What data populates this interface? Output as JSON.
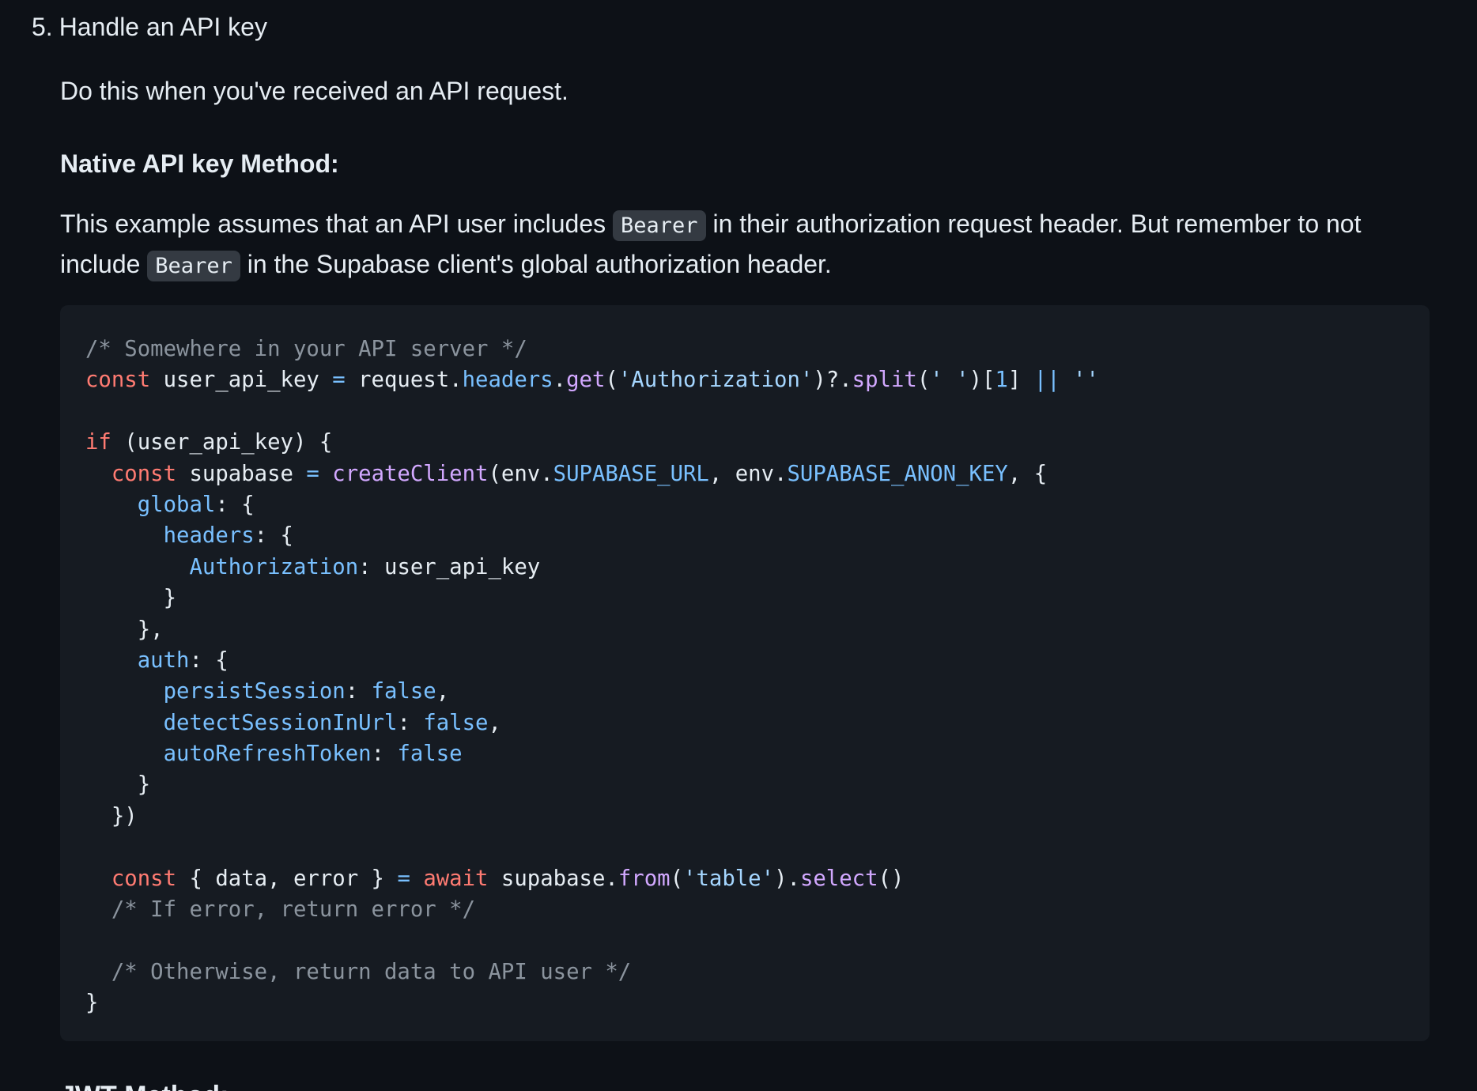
{
  "step": {
    "number": "5.",
    "title": "Handle an API key"
  },
  "intro": "Do this when you've received an API request.",
  "method_heading": "Native API key Method:",
  "example": {
    "part1": "This example assumes that an API user includes ",
    "code1": "Bearer",
    "part2": " in their authorization request header. But remember to not include ",
    "code2": "Bearer",
    "part3": " in the Supabase client's global authorization header."
  },
  "code": {
    "language": "javascript",
    "lines": [
      [
        {
          "t": "comment",
          "v": "/* Somewhere in your API server */"
        }
      ],
      [
        {
          "t": "keyword",
          "v": "const"
        },
        {
          "t": "plain",
          "v": " user_api_key "
        },
        {
          "t": "op",
          "v": "="
        },
        {
          "t": "plain",
          "v": " request."
        },
        {
          "t": "prop",
          "v": "headers"
        },
        {
          "t": "plain",
          "v": "."
        },
        {
          "t": "func",
          "v": "get"
        },
        {
          "t": "plain",
          "v": "("
        },
        {
          "t": "string",
          "v": "'Authorization'"
        },
        {
          "t": "plain",
          "v": ")?."
        },
        {
          "t": "func",
          "v": "split"
        },
        {
          "t": "plain",
          "v": "("
        },
        {
          "t": "string",
          "v": "' '"
        },
        {
          "t": "plain",
          "v": ")["
        },
        {
          "t": "number",
          "v": "1"
        },
        {
          "t": "plain",
          "v": "] "
        },
        {
          "t": "op",
          "v": "||"
        },
        {
          "t": "plain",
          "v": " "
        },
        {
          "t": "string",
          "v": "''"
        }
      ],
      [],
      [
        {
          "t": "keyword",
          "v": "if"
        },
        {
          "t": "plain",
          "v": " (user_api_key) {"
        }
      ],
      [
        {
          "t": "plain",
          "v": "  "
        },
        {
          "t": "keyword",
          "v": "const"
        },
        {
          "t": "plain",
          "v": " supabase "
        },
        {
          "t": "op",
          "v": "="
        },
        {
          "t": "plain",
          "v": " "
        },
        {
          "t": "func",
          "v": "createClient"
        },
        {
          "t": "plain",
          "v": "(env."
        },
        {
          "t": "prop",
          "v": "SUPABASE_URL"
        },
        {
          "t": "plain",
          "v": ", env."
        },
        {
          "t": "prop",
          "v": "SUPABASE_ANON_KEY"
        },
        {
          "t": "plain",
          "v": ", {"
        }
      ],
      [
        {
          "t": "plain",
          "v": "    "
        },
        {
          "t": "prop",
          "v": "global"
        },
        {
          "t": "plain",
          "v": ": {"
        }
      ],
      [
        {
          "t": "plain",
          "v": "      "
        },
        {
          "t": "prop",
          "v": "headers"
        },
        {
          "t": "plain",
          "v": ": {"
        }
      ],
      [
        {
          "t": "plain",
          "v": "        "
        },
        {
          "t": "prop",
          "v": "Authorization"
        },
        {
          "t": "plain",
          "v": ": user_api_key"
        }
      ],
      [
        {
          "t": "plain",
          "v": "      }"
        }
      ],
      [
        {
          "t": "plain",
          "v": "    },"
        }
      ],
      [
        {
          "t": "plain",
          "v": "    "
        },
        {
          "t": "prop",
          "v": "auth"
        },
        {
          "t": "plain",
          "v": ": {"
        }
      ],
      [
        {
          "t": "plain",
          "v": "      "
        },
        {
          "t": "prop",
          "v": "persistSession"
        },
        {
          "t": "plain",
          "v": ": "
        },
        {
          "t": "prop",
          "v": "false"
        },
        {
          "t": "plain",
          "v": ","
        }
      ],
      [
        {
          "t": "plain",
          "v": "      "
        },
        {
          "t": "prop",
          "v": "detectSessionInUrl"
        },
        {
          "t": "plain",
          "v": ": "
        },
        {
          "t": "prop",
          "v": "false"
        },
        {
          "t": "plain",
          "v": ","
        }
      ],
      [
        {
          "t": "plain",
          "v": "      "
        },
        {
          "t": "prop",
          "v": "autoRefreshToken"
        },
        {
          "t": "plain",
          "v": ": "
        },
        {
          "t": "prop",
          "v": "false"
        }
      ],
      [
        {
          "t": "plain",
          "v": "    }"
        }
      ],
      [
        {
          "t": "plain",
          "v": "  })"
        }
      ],
      [],
      [
        {
          "t": "plain",
          "v": "  "
        },
        {
          "t": "keyword",
          "v": "const"
        },
        {
          "t": "plain",
          "v": " { data, error } "
        },
        {
          "t": "op",
          "v": "="
        },
        {
          "t": "plain",
          "v": " "
        },
        {
          "t": "keyword",
          "v": "await"
        },
        {
          "t": "plain",
          "v": " supabase."
        },
        {
          "t": "func",
          "v": "from"
        },
        {
          "t": "plain",
          "v": "("
        },
        {
          "t": "string",
          "v": "'table'"
        },
        {
          "t": "plain",
          "v": ")."
        },
        {
          "t": "func",
          "v": "select"
        },
        {
          "t": "plain",
          "v": "()"
        }
      ],
      [
        {
          "t": "plain",
          "v": "  "
        },
        {
          "t": "comment",
          "v": "/* If error, return error */"
        }
      ],
      [],
      [
        {
          "t": "plain",
          "v": "  "
        },
        {
          "t": "comment",
          "v": "/* Otherwise, return data to API user */"
        }
      ],
      [
        {
          "t": "plain",
          "v": "}"
        }
      ]
    ]
  },
  "next_heading": "JWT Method:",
  "colors": {
    "background": "#0d1117",
    "code_background": "#161b22",
    "inline_code_background": "#343a42",
    "text": "#e6edf3",
    "comment": "#8b949e",
    "keyword": "#ff7b72",
    "property": "#79c0ff",
    "function": "#d2a8ff",
    "string": "#a5d6ff"
  }
}
